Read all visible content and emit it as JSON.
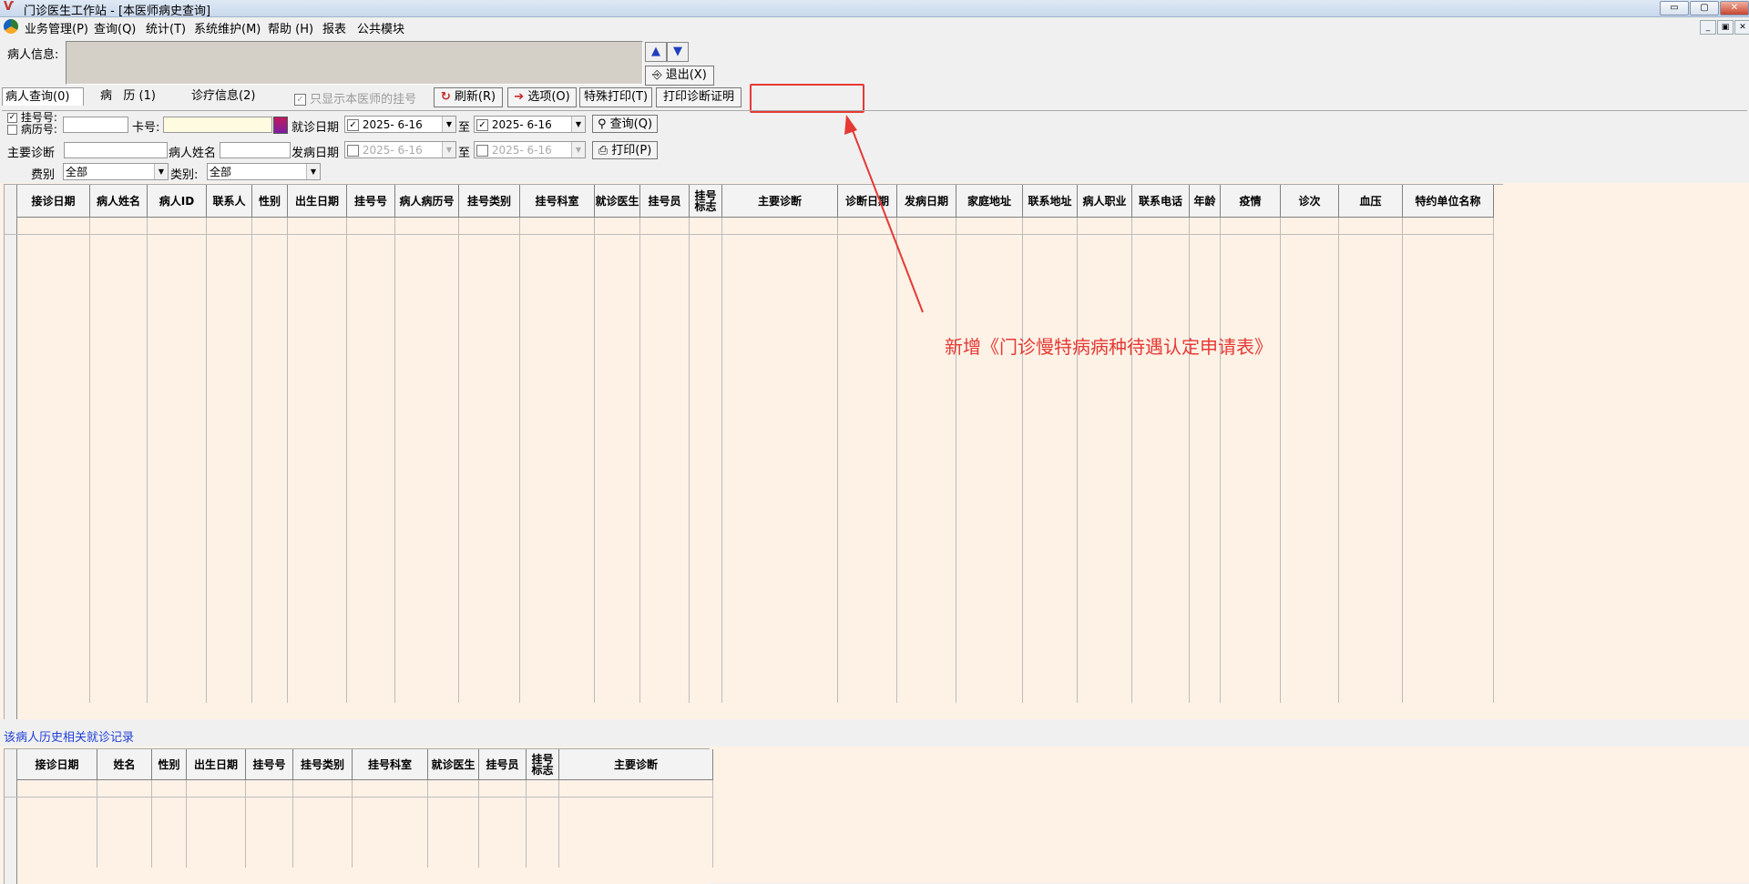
{
  "window": {
    "title": "门诊医生工作站 - [本医师病史查询]",
    "controls": [
      "▭",
      "▢",
      "✕"
    ],
    "mdi_controls": [
      "_",
      "▣",
      "✕"
    ]
  },
  "menu": [
    "业务管理(P)",
    "查询(Q)",
    "统计(T)",
    "系统维护(M)",
    "帮助 (H)",
    "报表",
    "公共模块"
  ],
  "patient_info": {
    "label": "病人信息:",
    "value": "",
    "up_arrow": "▲",
    "down_arrow": "▼",
    "exit_label": "退出(X)"
  },
  "tabs": [
    "病人查询(0)",
    "病   历 (1)",
    "诊疗信息(2)"
  ],
  "toolbar": {
    "only_mine_label": "只显示本医师的挂号",
    "refresh": "刷新(R)",
    "options": "选项(O)",
    "special_print": "特殊打印(T)",
    "print_cert": "打印诊断证明",
    "new_button_area": ""
  },
  "query": {
    "reg_no_label": "挂号号:",
    "record_no_label": "病历号:",
    "card_label": "卡号:",
    "visit_date_label": "就诊日期",
    "visit_from": "2025- 6-16",
    "to_label": "至",
    "visit_to": "2025- 6-16",
    "query_btn": "查询(Q)",
    "main_diag_label": "主要诊断",
    "name_label": "病人姓名",
    "onset_date_label": "发病日期",
    "onset_from": "2025- 6-16",
    "onset_to": "2025- 6-16",
    "print_btn": "打印(P)",
    "fee_label": "费别",
    "fee_value": "全部",
    "category_label": "类别:",
    "category_value": "全部"
  },
  "main_grid": {
    "columns": [
      "接诊日期",
      "病人姓名",
      "病人ID",
      "联系人",
      "性别",
      "出生日期",
      "挂号号",
      "病人病历号",
      "挂号类别",
      "挂号科室",
      "就诊医生",
      "挂号员",
      "挂号标志",
      "主要诊断",
      "诊断日期",
      "发病日期",
      "家庭地址",
      "联系地址",
      "病人职业",
      "联系电话",
      "年龄",
      "疫情",
      "诊次",
      "血压",
      "特约单位名称"
    ],
    "rows": []
  },
  "history": {
    "title": "该病人历史相关就诊记录",
    "columns": [
      "接诊日期",
      "姓名",
      "性别",
      "出生日期",
      "挂号号",
      "挂号类别",
      "挂号科室",
      "就诊医生",
      "挂号员",
      "挂号标志",
      "主要诊断"
    ],
    "rows": []
  },
  "annotation": "新增《门诊慢特病病种待遇认定申请表》",
  "colors": {
    "annotation": "#e53935",
    "grid_bg": "#fef2e6",
    "link": "#1f3fd6"
  }
}
